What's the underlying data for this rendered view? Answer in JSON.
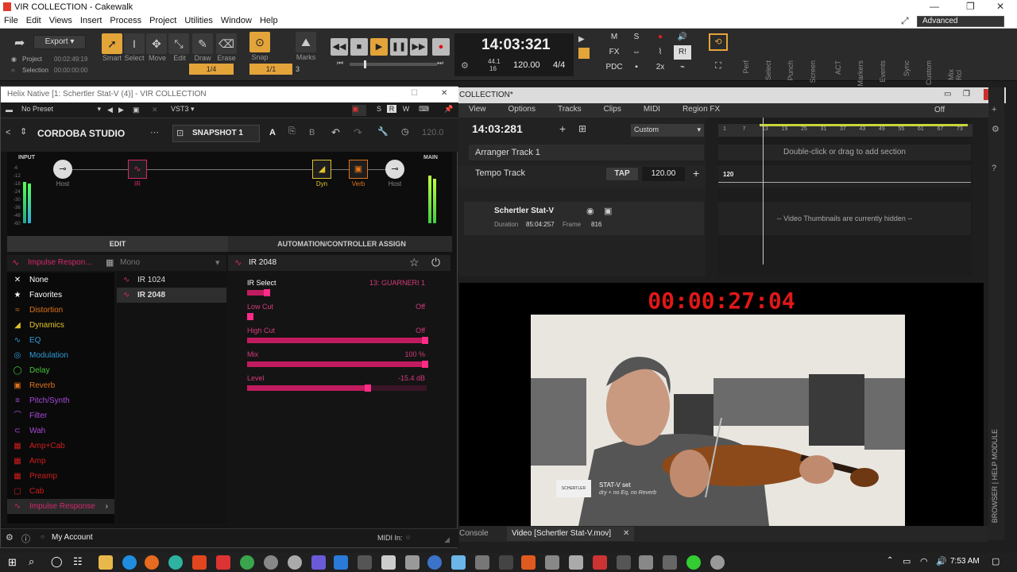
{
  "window": {
    "title": "VIR COLLECTION - Cakewalk",
    "advanced_label": "Advanced"
  },
  "menu": [
    "File",
    "Edit",
    "Views",
    "Insert",
    "Process",
    "Project",
    "Utilities",
    "Window",
    "Help"
  ],
  "control_bar": {
    "export_label": "Export",
    "project_label": "Project",
    "project_time": "00:02:49:19",
    "selection_label": "Selection",
    "selection_time": "00:00:00:00",
    "tools": [
      "Smart",
      "Select",
      "Move",
      "Edit",
      "Draw",
      "Erase"
    ],
    "snap_label": "Snap",
    "snap_value": "1/4",
    "snap_res": "1/1",
    "snap_count": "3",
    "marks_label": "Marks",
    "time": "14:03:321",
    "sample_rate": "44.1",
    "bit_depth": "16",
    "tempo": "120.00",
    "meter": "4/4",
    "mix_buttons": [
      "M",
      "S",
      "FX",
      "PDC",
      "2x"
    ],
    "ri_label": "R!",
    "side_modules": [
      "Perf",
      "Select",
      "Punch",
      "Screen",
      "ACT",
      "Markers",
      "Events",
      "Sync",
      "Custom",
      "Mix Rcl"
    ]
  },
  "helix": {
    "title": "Helix Native [1: Schertler Stat-V (4)] - VIR COLLECTION",
    "preset": "No Preset",
    "format": "VST3",
    "toolbar_letters": [
      "S",
      "R",
      "W"
    ],
    "rig_name": "CORDOBA STUDIO",
    "snapshot": "SNAPSHOT 1",
    "ab_a": "A",
    "ab_b": "B",
    "tempo": "120.0",
    "input_label": "INPUT",
    "main_label": "MAIN",
    "meter_ticks": [
      "-6",
      "-12",
      "-18",
      "-24",
      "-30",
      "-36",
      "-48",
      "-60"
    ],
    "chain": {
      "host_in": "Host",
      "ir": "IR",
      "dyn": "Dyn",
      "verb": "Verb",
      "host_out": "Host"
    },
    "tab_edit": "EDIT",
    "tab_auto": "AUTOMATION/CONTROLLER ASSIGN",
    "category_header": "Impulse Respon...",
    "mode": "Mono",
    "block_name": "IR 2048",
    "categories": [
      {
        "name": "None",
        "color": "#ffffff",
        "icon": "✕"
      },
      {
        "name": "Favorites",
        "color": "#ffffff",
        "icon": "★"
      },
      {
        "name": "Distortion",
        "color": "#e0741c",
        "icon": "≈"
      },
      {
        "name": "Dynamics",
        "color": "#e2c32a",
        "icon": "◢"
      },
      {
        "name": "EQ",
        "color": "#2f9ad8",
        "icon": "∿"
      },
      {
        "name": "Modulation",
        "color": "#2f9ad8",
        "icon": "◎"
      },
      {
        "name": "Delay",
        "color": "#45c33a",
        "icon": "◯"
      },
      {
        "name": "Reverb",
        "color": "#e0741c",
        "icon": "▣"
      },
      {
        "name": "Pitch/Synth",
        "color": "#a64ad8",
        "icon": "≡"
      },
      {
        "name": "Filter",
        "color": "#a64ad8",
        "icon": "⌒"
      },
      {
        "name": "Wah",
        "color": "#a64ad8",
        "icon": "⊂"
      },
      {
        "name": "Amp+Cab",
        "color": "#d11c1c",
        "icon": "▦"
      },
      {
        "name": "Amp",
        "color": "#d11c1c",
        "icon": "▦"
      },
      {
        "name": "Preamp",
        "color": "#d11c1c",
        "icon": "▦"
      },
      {
        "name": "Cab",
        "color": "#d11c1c",
        "icon": "▢"
      },
      {
        "name": "Impulse Response",
        "color": "#d6286d",
        "icon": "∿"
      }
    ],
    "models": [
      "IR 1024",
      "IR 2048"
    ],
    "params": [
      {
        "name": "IR Select",
        "value": "13: GUARNERI 1",
        "fraction": 0.12
      },
      {
        "name": "Low Cut",
        "value": "Off",
        "fraction": 0.0
      },
      {
        "name": "High Cut",
        "value": "Off",
        "fraction": 1.0
      },
      {
        "name": "Mix",
        "value": "100 %",
        "fraction": 1.0
      },
      {
        "name": "Level",
        "value": "-15.4 dB",
        "fraction": 0.68
      }
    ],
    "account": "My Account",
    "midi_in": "MIDI In:"
  },
  "cakewalk": {
    "title": "COLLECTION*",
    "menus": [
      "View",
      "Options",
      "Tracks",
      "Clips",
      "MIDI",
      "Region FX"
    ],
    "off_label": "Off",
    "now_time": "14:03:281",
    "custom_label": "Custom",
    "arranger_track": "Arranger Track 1",
    "tempo_track": "Tempo Track",
    "tap_label": "TAP",
    "tempo_value": "120.00",
    "ruler_marks": [
      "1",
      "7",
      "13",
      "19",
      "25",
      "31",
      "37",
      "43",
      "49",
      "55",
      "61",
      "67",
      "73"
    ],
    "section_hint": "Double-click or drag to add section",
    "tempo_marker": "120",
    "video_track_name": "Schertler Stat-V",
    "duration_label": "Duration",
    "duration_value": "85:04:257",
    "frame_label": "Frame",
    "frame_value": "816",
    "thumb_hint": "-- Video Thumbnails are currently hidden --",
    "video_time": "00:00:27:04",
    "overlay_title": "STAT-V set",
    "overlay_sub": "dry + no Eq, no Reverb",
    "overlay_brand": "SCHERTLER",
    "tab_console": "Console",
    "tab_video": "Video [Schertler Stat-V.mov]",
    "side_label": "BROWSER | HELP MODULE"
  },
  "taskbar": {
    "time": "7:53 AM"
  }
}
